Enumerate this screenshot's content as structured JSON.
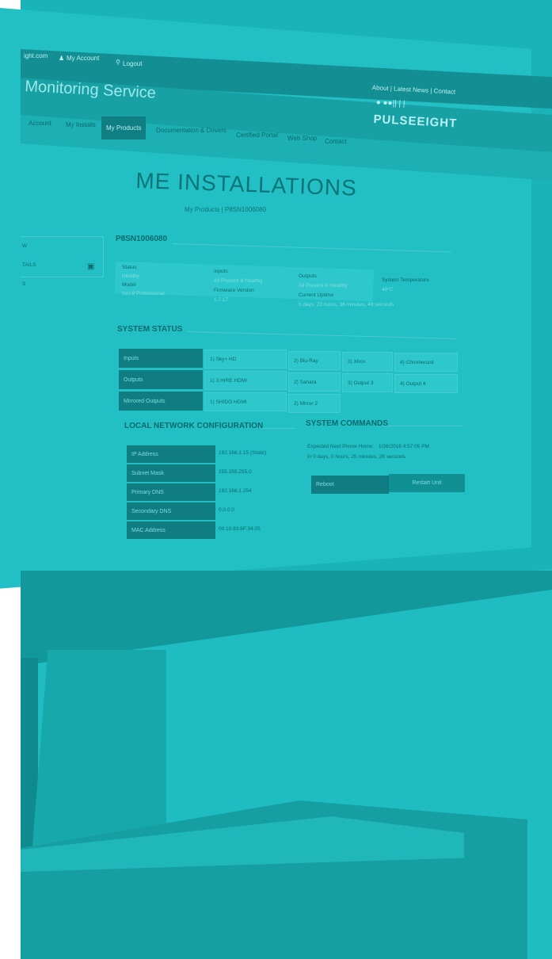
{
  "topbar": {
    "site_fragment": "ight.com",
    "my_account": "My Account",
    "logout": "Logout"
  },
  "header": {
    "title": "Monitoring Service",
    "links": "About | Latest News | Contact",
    "brand_top": "● ●●|| | |",
    "brand_name": "PULSEEIGHT"
  },
  "nav": {
    "items": [
      "Account",
      "My Installs",
      "My Products",
      "Documentation & Drivers",
      "Certified Portal",
      "Web Shop",
      "Contact"
    ],
    "active_index": 2
  },
  "page": {
    "heading": "ME INSTALLATIONS",
    "breadcrumb": "My Products  |  P8SN1006080"
  },
  "sidebar": {
    "items": [
      "W",
      "TAILS",
      "S"
    ]
  },
  "device": {
    "serial": "P8SN1006080",
    "info": {
      "status_label": "Status",
      "status_value": "Healthy",
      "model_label": "Model",
      "model_value": "neo:8 Professional",
      "inputs_label": "Inputs",
      "inputs_value": "All Present & Healthy",
      "firmware_label": "Firmware Version",
      "firmware_value": "1.7.17",
      "outputs_label": "Outputs",
      "outputs_value": "All Present & Healthy",
      "uptime_label": "Current Uptime",
      "uptime_value": "5 days, 23 hours, 36 minutes, 49 seconds",
      "temp_label": "System Temperature",
      "temp_value": "48°C"
    }
  },
  "system_status": {
    "title": "SYSTEM STATUS",
    "rows": [
      {
        "label": "Inputs",
        "cells": [
          "1) Sky+ HD",
          "2) Blu-Ray",
          "3) Xbox",
          "4) Chromecast"
        ]
      },
      {
        "label": "Outputs",
        "cells": [
          "1) 3 HIRE HDMI",
          "2) Sahara",
          "3) Output 3",
          "4) Output 4"
        ]
      },
      {
        "label": "Mirrored Outputs",
        "cells": [
          "1) SHIDO HDMI",
          "2) Mirror 2"
        ]
      }
    ]
  },
  "network": {
    "title": "LOCAL NETWORK CONFIGURATION",
    "rows": [
      {
        "label": "IP Address",
        "value": "192.168.1.15 (Static)"
      },
      {
        "label": "Subnet Mask",
        "value": "255.255.255.0"
      },
      {
        "label": "Primary DNS",
        "value": "192.168.1.254"
      },
      {
        "label": "Secondary DNS",
        "value": "0.0.0.0"
      },
      {
        "label": "MAC Address",
        "value": "00:10:83:8F:34:05"
      }
    ]
  },
  "commands": {
    "title": "SYSTEM COMMANDS",
    "expected_label": "Expected Next Phone Home:",
    "expected_value": "1/26/2016 4:57:05 PM",
    "countdown": "In 0 days, 0 hours, 25 minutes, 28 seconds",
    "reboot_label": "Reboot",
    "restart_label": "Restart Unit"
  }
}
